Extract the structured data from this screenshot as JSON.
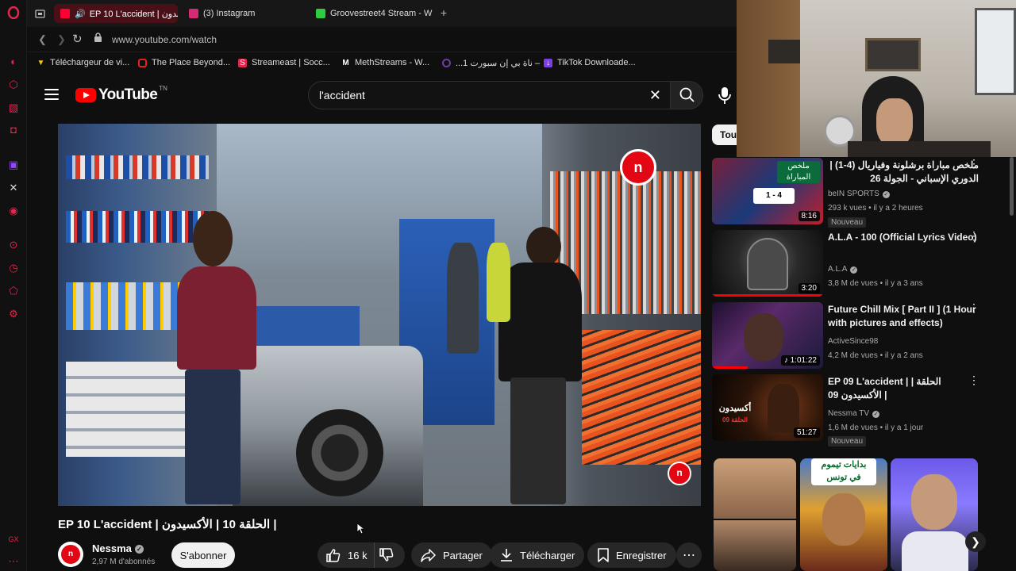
{
  "browser": {
    "tabs": [
      {
        "label": "EP 10 L'accident | بدون",
        "color": "#ff0033",
        "active": true
      },
      {
        "label": "(3) Instagram",
        "color": "#d62976",
        "active": false
      },
      {
        "label": "Groovestreet4 Stream - W",
        "color": "#2ecc40",
        "active": false
      }
    ],
    "new_tab": "+",
    "url": "www.youtube.com/watch",
    "bookmarks": [
      {
        "label": "Téléchargeur de vi...",
        "color": "#f4c20d"
      },
      {
        "label": "The Place Beyond...",
        "color": "#e62117"
      },
      {
        "label": "Streameast | Socc...",
        "color": "#e2264d"
      },
      {
        "label": "MethStreams - W...",
        "color": "#ffffff"
      },
      {
        "label": "...ناة بي إن سبورت 1 –",
        "color": "#6b3fa0"
      },
      {
        "label": "TikTok Downloade...",
        "color": "#7b3fe4"
      }
    ]
  },
  "youtube": {
    "region": "TN",
    "logo_text": "YouTube",
    "search_value": "l'accident",
    "video": {
      "title": "EP 10 L'accident | الحلقة 10 | الأكسيدون |",
      "channel": "Nessma",
      "subscribers": "2,97 M d'abonnés",
      "subscribe_label": "S'abonner",
      "likes": "16 k",
      "share_label": "Partager",
      "download_label": "Télécharger",
      "save_label": "Enregistrer"
    },
    "filter_chip": "Tout",
    "recommendations": [
      {
        "title": "ملخص مباراة برشلونة وفياريال (4-1) | الدوري الإسباني - الجولة 26",
        "channel": "beIN SPORTS",
        "verified": true,
        "stats": "293 k vues • il y a 2 heures",
        "badge": "Nouveau",
        "duration": "8:16",
        "progress": 0
      },
      {
        "title": "A.L.A - 100 (Official Lyrics Video)",
        "channel": "A.L.A",
        "verified": true,
        "stats": "3,8 M de vues • il y a 3 ans",
        "badge": "",
        "duration": "3:20",
        "progress": 1.0
      },
      {
        "title": "Future Chill Mix [ Part II ] (1 Hour with pictures and effects)",
        "channel": "ActiveSince98",
        "verified": false,
        "stats": "4,2 M de vues • il y a 2 ans",
        "badge": "",
        "duration": "1:01:22",
        "progress": 0.32
      },
      {
        "title": "EP 09 L'accident | الحلقة | الأكسيدون 09 |",
        "channel": "Nessma TV",
        "verified": true,
        "stats": "1,6 M de vues • il y a 1 jour",
        "badge": "Nouveau",
        "duration": "51:27",
        "progress": 0
      }
    ]
  }
}
